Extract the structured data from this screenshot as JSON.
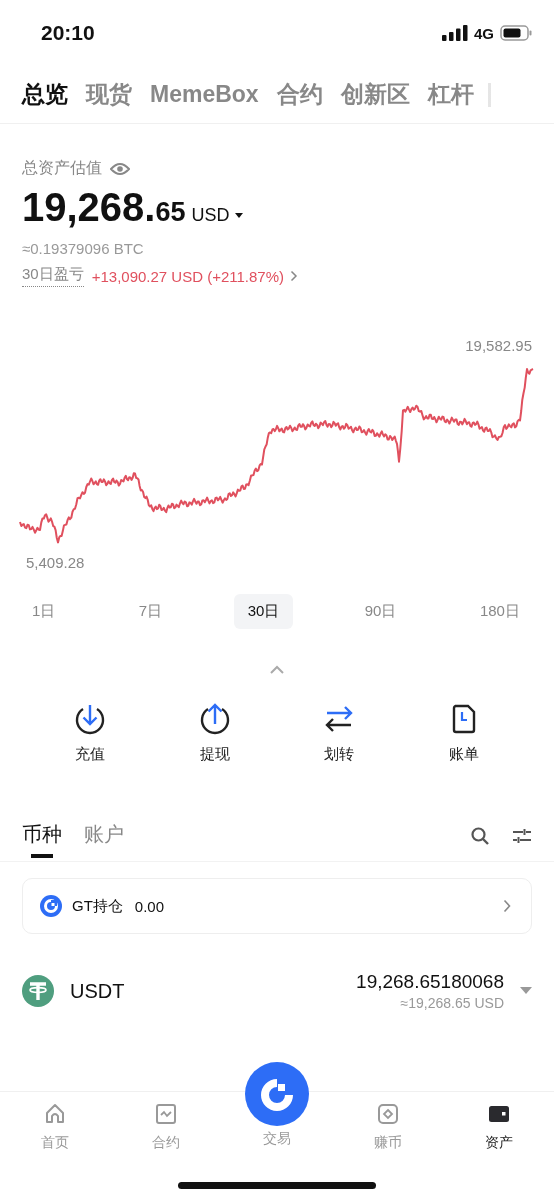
{
  "status_bar": {
    "time": "20:10",
    "network": "4G"
  },
  "tabs": [
    {
      "label": "总览",
      "selected": true
    },
    {
      "label": "现货",
      "selected": false
    },
    {
      "label": "MemeBox",
      "selected": false
    },
    {
      "label": "合约",
      "selected": false
    },
    {
      "label": "创新区",
      "selected": false
    },
    {
      "label": "杠杆",
      "selected": false
    }
  ],
  "summary": {
    "label": "总资产估值",
    "integer": "19,268.",
    "decimals": "65",
    "currency": "USD",
    "btc": "≈0.19379096 BTC",
    "pnl_label": "30日盈亏",
    "pnl": "+13,090.27 USD (+211.87%)"
  },
  "chart": {
    "max_label": "19,582.95",
    "min_label": "5,409.28"
  },
  "periods": [
    {
      "label": "1日",
      "selected": false
    },
    {
      "label": "7日",
      "selected": false
    },
    {
      "label": "30日",
      "selected": true
    },
    {
      "label": "90日",
      "selected": false
    },
    {
      "label": "180日",
      "selected": false
    }
  ],
  "actions": [
    {
      "label": "充值",
      "kind": "deposit"
    },
    {
      "label": "提现",
      "kind": "withdraw"
    },
    {
      "label": "划转",
      "kind": "transfer"
    },
    {
      "label": "账单",
      "kind": "bill"
    }
  ],
  "list_tabs": [
    {
      "label": "币种",
      "selected": true
    },
    {
      "label": "账户",
      "selected": false
    }
  ],
  "gt_card": {
    "label": "GT持仓",
    "value": "0.00"
  },
  "assets": [
    {
      "symbol": "USDT",
      "amount": "19,268.65180068",
      "value": "≈19,268.65 USD"
    }
  ],
  "nav": [
    {
      "label": "首页",
      "kind": "home",
      "selected": false
    },
    {
      "label": "合约",
      "kind": "futures",
      "selected": false
    },
    {
      "label": "交易",
      "kind": "trade",
      "selected": false
    },
    {
      "label": "赚币",
      "kind": "earn",
      "selected": false
    },
    {
      "label": "资产",
      "kind": "assets",
      "selected": true
    }
  ]
}
